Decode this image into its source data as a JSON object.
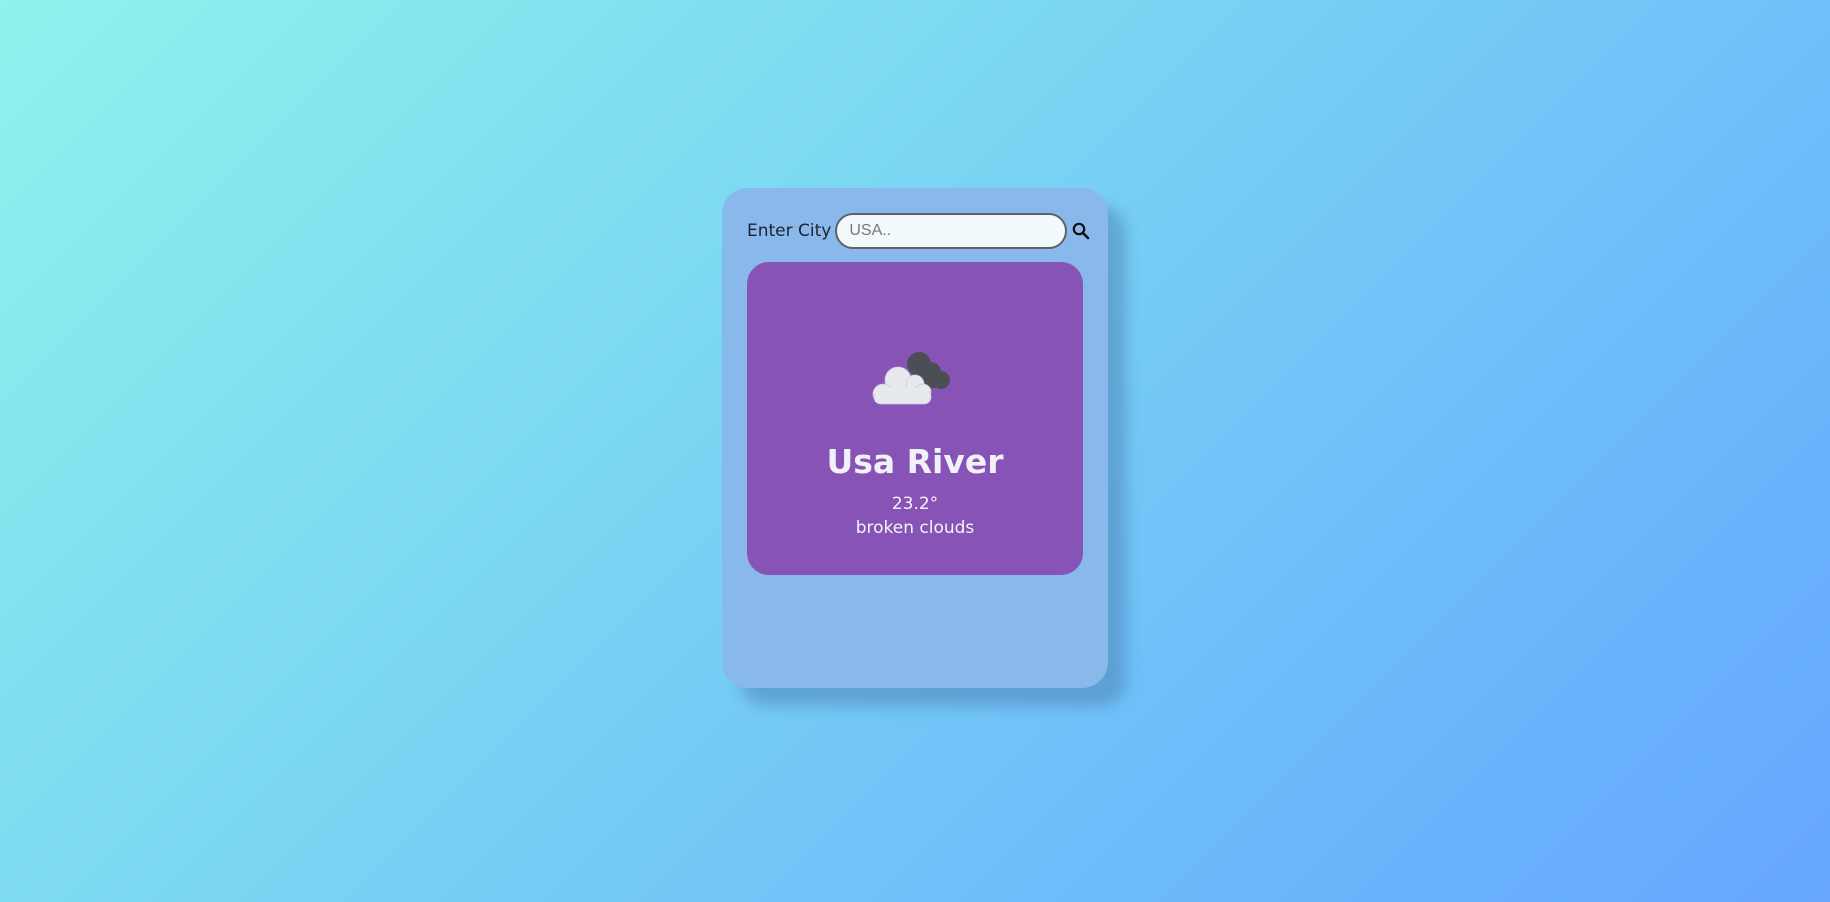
{
  "search": {
    "label": "Enter City",
    "placeholder": "USA..",
    "value": "",
    "button_icon": "search-icon"
  },
  "weather": {
    "icon": "broken-clouds-icon",
    "city": "Usa River",
    "temperature": "23.2°",
    "description": "broken clouds"
  },
  "colors": {
    "background_start": "#8ef3ec",
    "background_end": "#66a6ff",
    "app_card": "#89b9ea",
    "weather_card": "#8853b6",
    "text_light": "#f1f1f8"
  }
}
